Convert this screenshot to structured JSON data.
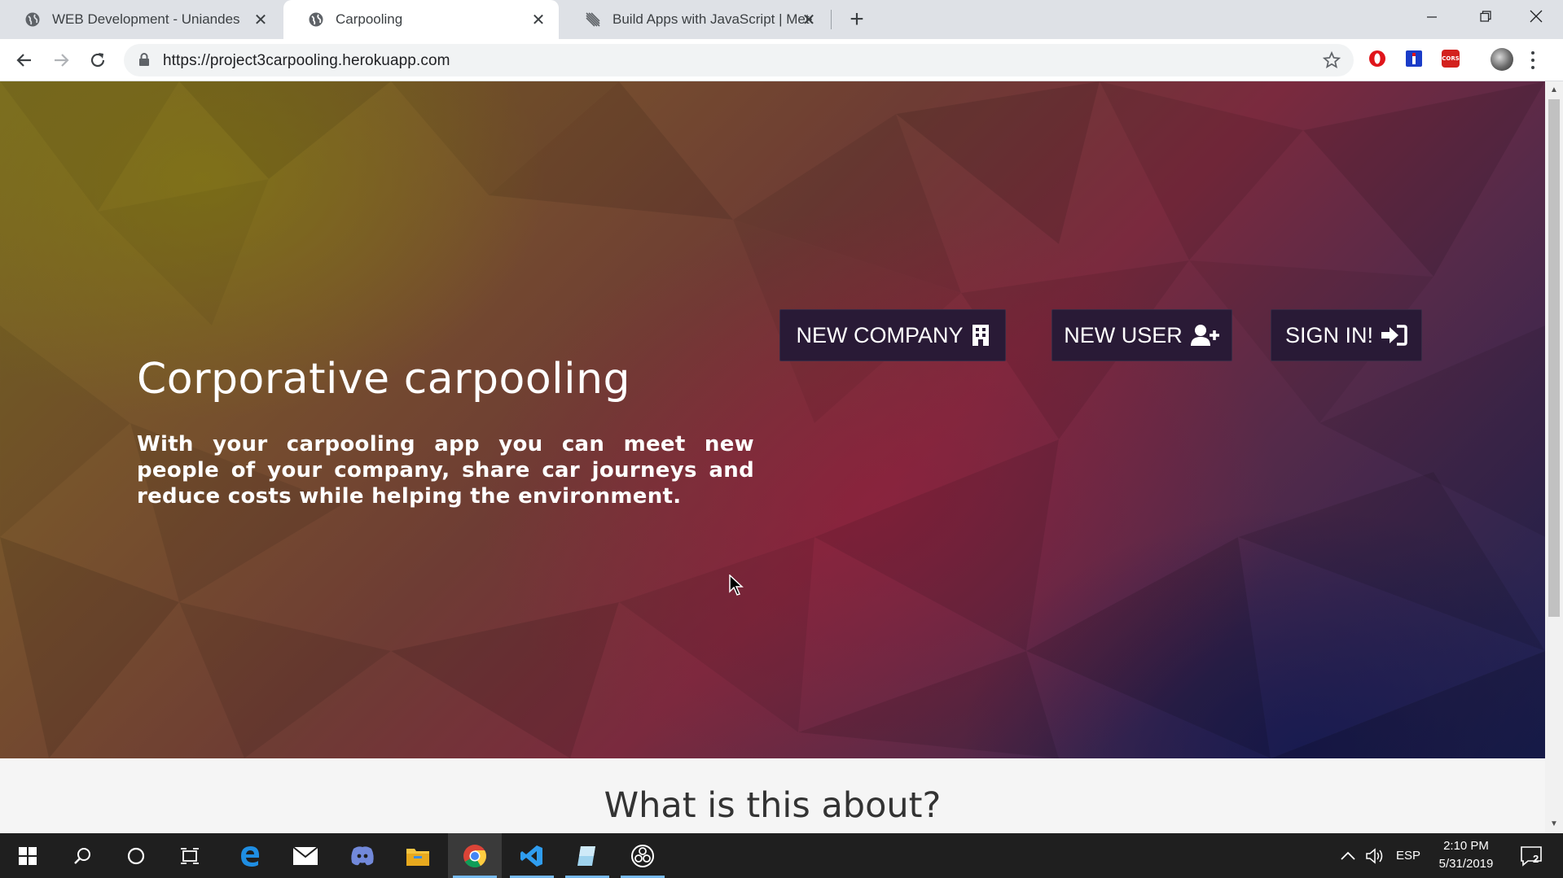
{
  "browser": {
    "tabs": [
      {
        "title": "WEB Development - Uniandes",
        "active": false,
        "favicon": "globe-icon"
      },
      {
        "title": "Carpooling",
        "active": true,
        "favicon": "globe-icon"
      },
      {
        "title": "Build Apps with JavaScript | Mete",
        "active": false,
        "favicon": "meteor-icon"
      }
    ],
    "url": "https://project3carpooling.herokuapp.com",
    "extensions": [
      "opera-icon",
      "extension-blue-icon",
      "cors-icon"
    ],
    "cors_label": "CORS"
  },
  "page": {
    "hero": {
      "title": "Corporative carpooling",
      "text": "With your carpooling app you can meet new people of your company, share car journeys and reduce costs while helping the environment.",
      "buttons": {
        "new_company": "NEW COMPANY",
        "new_user": "NEW USER",
        "sign_in": "SIGN IN!"
      }
    },
    "section_title": "What is this about?"
  },
  "taskbar": {
    "apps": [
      "windows-start-icon",
      "search-icon",
      "cortana-icon",
      "task-view-icon",
      "edge-icon",
      "mail-icon",
      "discord-icon",
      "file-explorer-icon",
      "chrome-icon",
      "vscode-icon",
      "app-icon",
      "obs-icon"
    ],
    "language": "ESP",
    "time": "2:10 PM",
    "date": "5/31/2019",
    "notifications": "2"
  },
  "colors": {
    "button_bg": "#291a36",
    "tabstrip_bg": "#dee1e6",
    "taskbar_bg": "#1f1f1f",
    "taskbar_accent": "#76b9ed"
  }
}
